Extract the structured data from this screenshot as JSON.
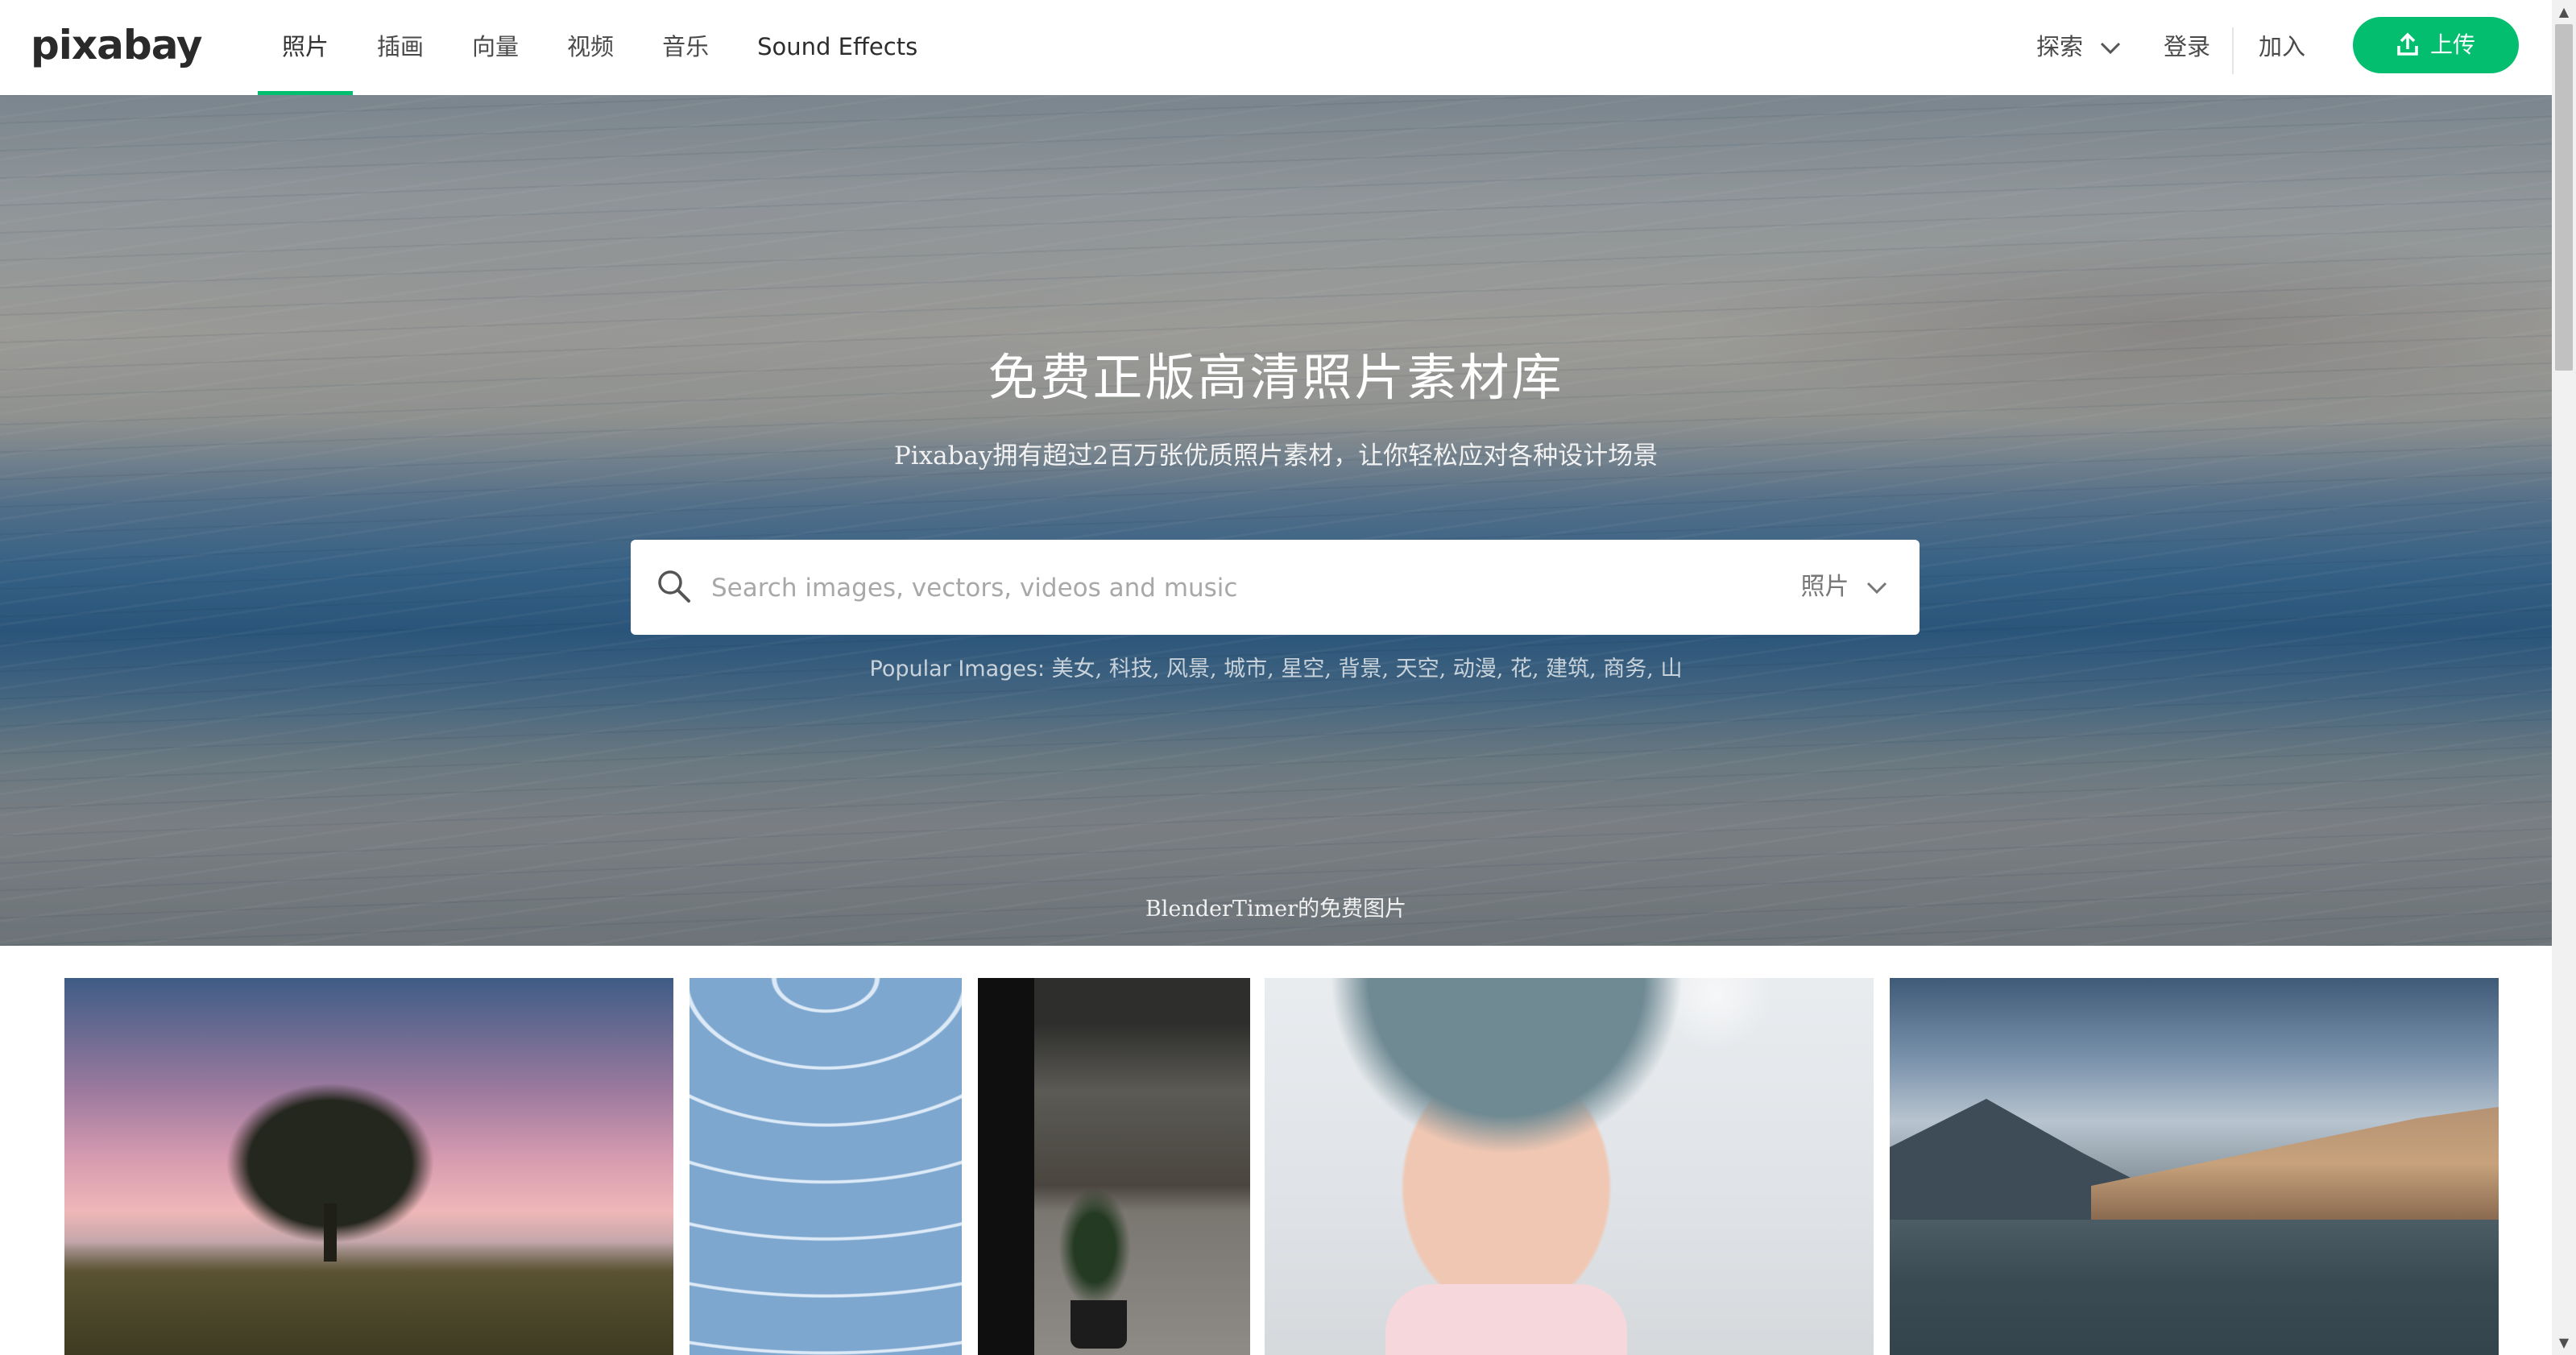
{
  "header": {
    "logo": "pixabay",
    "nav": [
      {
        "label": "照片",
        "active": true
      },
      {
        "label": "插画",
        "active": false
      },
      {
        "label": "向量",
        "active": false
      },
      {
        "label": "视频",
        "active": false
      },
      {
        "label": "音乐",
        "active": false
      },
      {
        "label": "Sound Effects",
        "active": false
      }
    ],
    "explore_label": "探索",
    "login_label": "登录",
    "join_label": "加入",
    "upload_label": "上传",
    "icons": {
      "explore": "chevron-down-icon",
      "upload": "upload-icon"
    }
  },
  "hero": {
    "title": "免费正版高清照片素材库",
    "subtitle": "Pixabay拥有超过2百万张优质照片素材，让你轻松应对各种设计场景",
    "search": {
      "placeholder": "Search images, vectors, videos and music",
      "value": "",
      "type_label": "照片",
      "icon": "search-icon"
    },
    "popular_label": "Popular Images:",
    "popular_terms": "美女, 科技, 风景, 城市, 星空, 背景, 天空, 动漫, 花, 建筑, 商务, 山",
    "credit": "BlenderTimer的免费图片"
  },
  "gallery": {
    "photos": [
      {
        "subject": "tree at sunset"
      },
      {
        "subject": "dewy spider web"
      },
      {
        "subject": "doorway with bonsai"
      },
      {
        "subject": "little girl"
      },
      {
        "subject": "lakeside town"
      }
    ]
  },
  "colors": {
    "accent": "#02be6e",
    "text": "#4a4a4a",
    "header_bg": "#ffffff"
  }
}
